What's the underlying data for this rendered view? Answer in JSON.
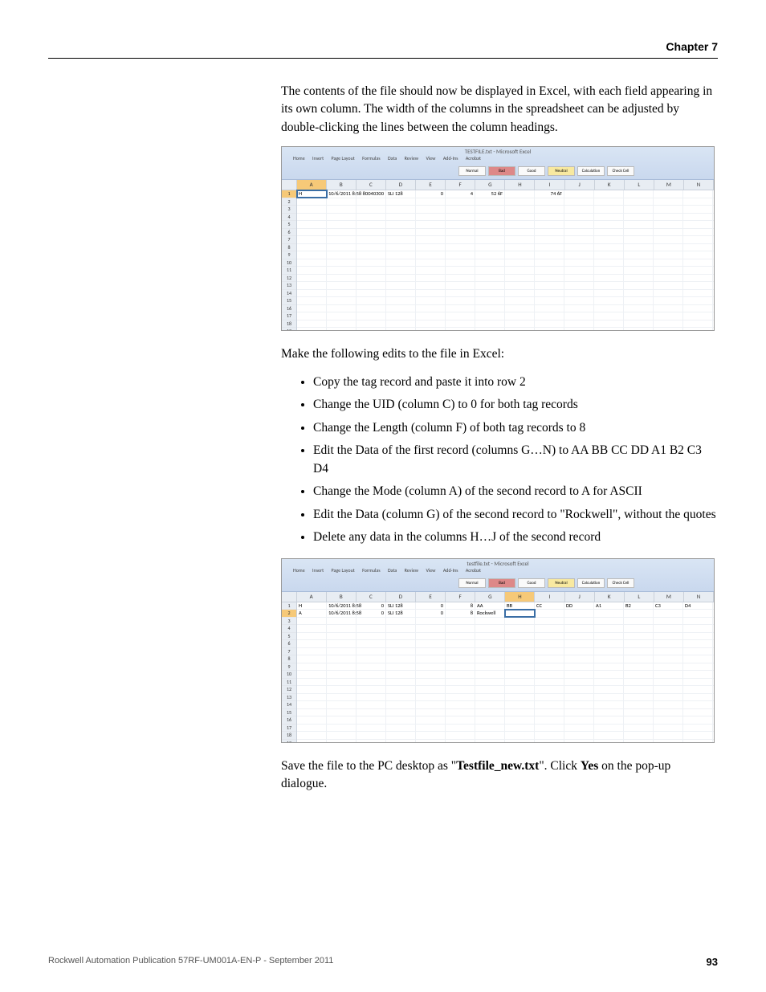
{
  "header": {
    "chapter": "Chapter 7"
  },
  "intro_para": "The contents of the file should now be displayed in Excel, with each field appearing in its own column. The width of the columns in the spreadsheet can be adjusted by double-clicking the lines between the column headings.",
  "edits_intro": "Make the following edits to the file in Excel:",
  "bullets": [
    "Copy the tag record and paste it into row 2",
    "Change the UID (column C) to 0 for both tag records",
    "Change the Length (column F) of both tag records to 8",
    "Edit the Data of the first record (columns G…N) to AA BB CC DD A1 B2 C3 D4",
    "Change the Mode (column A) of the second record to A for ASCII",
    "Edit the Data (column G) of the second record to \"Rockwell\", without the quotes",
    "Delete any data in the columns H…J of the second record"
  ],
  "save_para_pre": "Save the file to the PC desktop as \"",
  "save_filename": "Testfile_new.txt",
  "save_para_mid": "\". Click ",
  "save_yes": "Yes",
  "save_para_post": " on the pop-up dialogue.",
  "footer": {
    "pub": "Rockwell Automation Publication 57RF-UM001A-EN-P - September 2011",
    "page": "93"
  },
  "excel_common": {
    "tabs": [
      "Home",
      "Insert",
      "Page Layout",
      "Formulas",
      "Data",
      "Review",
      "View",
      "Add-Ins",
      "Acrobat"
    ],
    "styles": {
      "normal": "Normal",
      "bad": "Bad",
      "good": "Good",
      "neutral": "Neutral",
      "calc": "Calculation",
      "check": "Check Cell"
    },
    "cols": [
      "A",
      "B",
      "C",
      "D",
      "E",
      "F",
      "G",
      "H",
      "I",
      "J",
      "K",
      "L",
      "M",
      "N"
    ]
  },
  "shot1": {
    "title": "TESTFILE.txt  -  Microsoft Excel",
    "formula_ref": "A1",
    "row1": {
      "A": "H",
      "B": "10/6/2011 8:58",
      "C": "80040300",
      "D": "SLI 128",
      "E": "0",
      "F": "4",
      "G": "52 6F",
      "H": "",
      "I": "74 6F",
      "J": "",
      "K": "",
      "L": "",
      "M": "",
      "N": ""
    }
  },
  "shot2": {
    "title": "testfile.txt  -  Microsoft Excel",
    "formula_ref": "H2",
    "row1": {
      "A": "H",
      "B": "10/6/2011 8:58",
      "C": "0",
      "D": "SLI 128",
      "E": "0",
      "F": "8",
      "G": "AA",
      "H": "BB",
      "I": "CC",
      "J": "DD",
      "K": "A1",
      "L": "B2",
      "M": "C3",
      "N": "D4"
    },
    "row2": {
      "A": "A",
      "B": "10/6/2011 8:58",
      "C": "0",
      "D": "SLI 128",
      "E": "0",
      "F": "8",
      "G": "Rockwell",
      "H": "",
      "I": "",
      "J": "",
      "K": "",
      "L": "",
      "M": "",
      "N": ""
    }
  }
}
